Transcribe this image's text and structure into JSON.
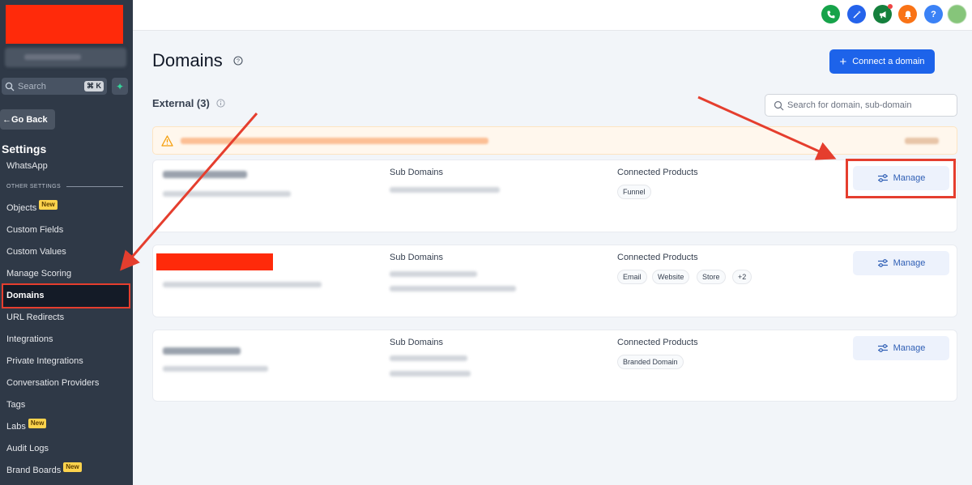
{
  "sidebar": {
    "search_placeholder": "Search",
    "search_shortcut": "⌘ K",
    "go_back": "Go Back",
    "settings_title": "Settings",
    "other_settings_label": "OTHER SETTINGS",
    "new_badge": "New",
    "items": [
      {
        "label": "WhatsApp"
      },
      {
        "label": "Objects",
        "badge": "New"
      },
      {
        "label": "Custom Fields"
      },
      {
        "label": "Custom Values"
      },
      {
        "label": "Manage Scoring"
      },
      {
        "label": "Domains",
        "active": true
      },
      {
        "label": "URL Redirects"
      },
      {
        "label": "Integrations"
      },
      {
        "label": "Private Integrations"
      },
      {
        "label": "Conversation Providers"
      },
      {
        "label": "Tags"
      },
      {
        "label": "Labs",
        "badge": "New"
      },
      {
        "label": "Audit Logs"
      },
      {
        "label": "Brand Boards",
        "badge": "New"
      }
    ]
  },
  "topbar": {
    "icons": [
      {
        "name": "phone-icon",
        "color": "#16a34a"
      },
      {
        "name": "magic-icon",
        "color": "#2563eb"
      },
      {
        "name": "megaphone-icon",
        "color": "#15803d"
      },
      {
        "name": "bell-icon",
        "color": "#f97316"
      },
      {
        "name": "help-icon",
        "color": "#3b82f6"
      },
      {
        "name": "avatar",
        "color": "#86c57a"
      }
    ],
    "help_glyph": "?"
  },
  "main": {
    "title": "Domains",
    "connect_button": "Connect a domain",
    "connect_plus": "+",
    "section_title": "External (3)",
    "search_placeholder": "Search for domain, sub-domain",
    "columns": {
      "sub_domains": "Sub Domains",
      "connected_products": "Connected Products"
    },
    "manage_label": "Manage",
    "cards": [
      {
        "products": [
          "Funnel"
        ]
      },
      {
        "products": [
          "Email",
          "Website",
          "Store",
          "+2"
        ]
      },
      {
        "products": [
          "Branded Domain"
        ]
      }
    ]
  },
  "colors": {
    "sidebar_bg": "#2f3947",
    "accent": "#1d63ea",
    "annotation_red": "#e53e2e",
    "redaction": "#ff2a0a"
  }
}
